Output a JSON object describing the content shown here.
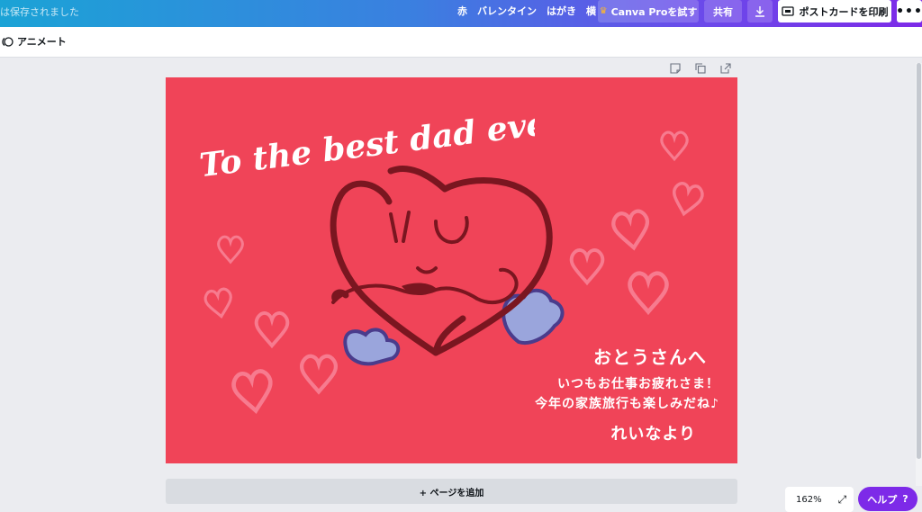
{
  "topbar": {
    "saved_status": "は保存されました",
    "doc_title": "赤　バレンタイン　はがき　横",
    "pro_label": "Canva Proを試す",
    "share_label": "共有",
    "print_label": "ポストカードを印刷",
    "more_label": "•••"
  },
  "subbar": {
    "animate_label": "アニメート"
  },
  "card": {
    "headline": "To the best dad ever!",
    "to": "おとうさんへ",
    "line1": "いつもお仕事お疲れさま！",
    "line2": "今年の家族旅行も楽しみだね♪",
    "sign": "れいなより",
    "background_color": "#f04458"
  },
  "add_page_label": "+ ページを追加",
  "zoom": {
    "level": "162%"
  },
  "help": {
    "label": "ヘルプ",
    "mark": "?"
  },
  "icons": [
    "crown-icon",
    "download-icon",
    "print-icon",
    "more-icon",
    "animate-icon",
    "note-icon",
    "duplicate-icon",
    "add-page-icon",
    "expand-icon"
  ],
  "colors": {
    "accent": "#7d2ae8",
    "heart_dark": "#7a1620",
    "wing": "#9aa5dc",
    "wing_outline": "#4a3c8c"
  }
}
